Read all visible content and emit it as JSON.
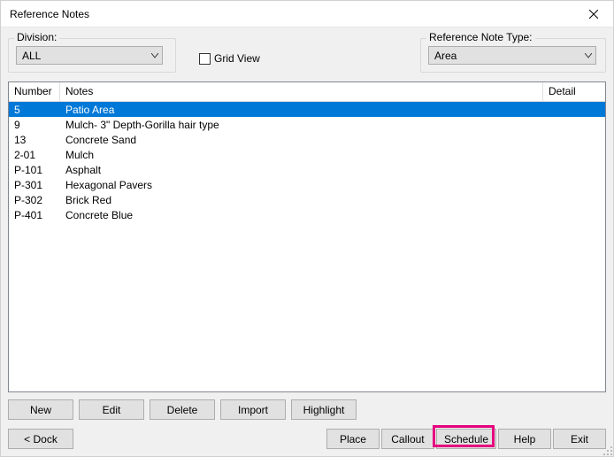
{
  "title": "Reference Notes",
  "division": {
    "label": "Division:",
    "value": "ALL"
  },
  "gridview_label": "Grid View",
  "reftype": {
    "label": "Reference Note Type:",
    "value": "Area"
  },
  "columns": {
    "number": "Number",
    "notes": "Notes",
    "detail": "Detail"
  },
  "rows": [
    {
      "number": "5",
      "notes": "Patio Area",
      "selected": true
    },
    {
      "number": "9",
      "notes": "Mulch- 3\" Depth-Gorilla hair type"
    },
    {
      "number": "13",
      "notes": "Concrete Sand"
    },
    {
      "number": "2-01",
      "notes": "Mulch"
    },
    {
      "number": "P-101",
      "notes": "Asphalt"
    },
    {
      "number": "P-301",
      "notes": "Hexagonal Pavers"
    },
    {
      "number": "P-302",
      "notes": "Brick Red"
    },
    {
      "number": "P-401",
      "notes": "Concrete Blue"
    }
  ],
  "buttons": {
    "new": "New",
    "edit": "Edit",
    "delete": "Delete",
    "import": "Import",
    "highlight": "Highlight",
    "dock": "< Dock",
    "place": "Place",
    "callout": "Callout",
    "schedule": "Schedule",
    "help": "Help",
    "exit": "Exit"
  },
  "highlighted_button": "schedule"
}
